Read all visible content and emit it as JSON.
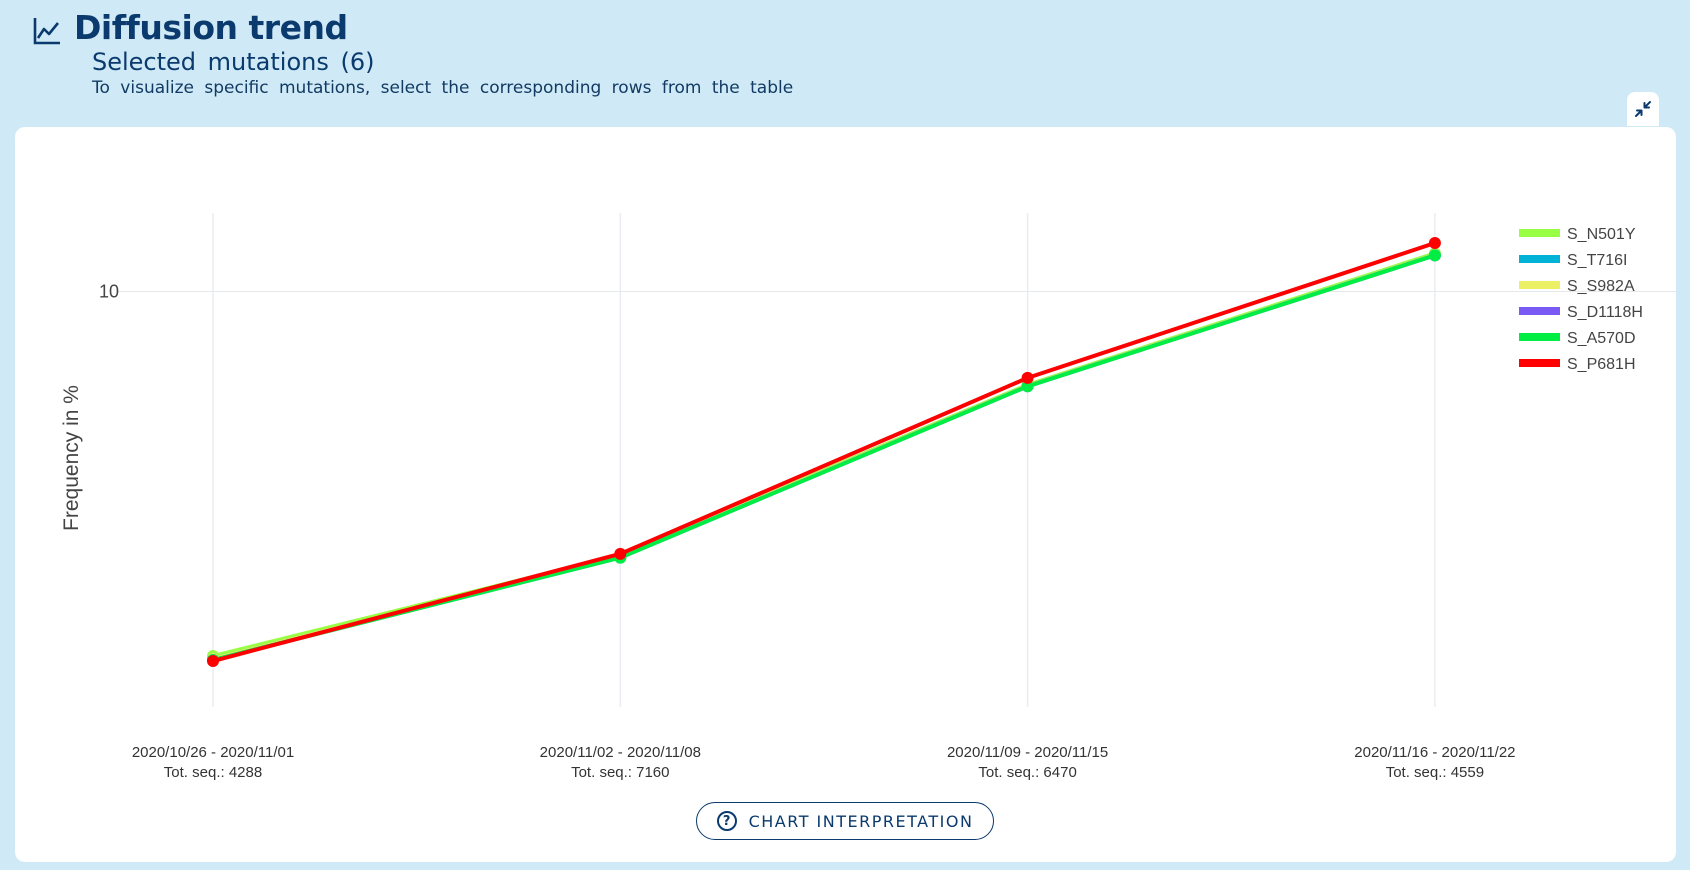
{
  "header": {
    "title": "Diffusion trend",
    "subtitle": "Selected mutations (6)",
    "hint": "To visualize specific mutations, select the corresponding rows from the table"
  },
  "icons": {
    "title": "line-chart-icon",
    "collapse": "collapse-arrows-icon",
    "help": "question-circle-icon"
  },
  "buttons": {
    "interpretation": "CHART INTERPRETATION",
    "help_glyph": "?"
  },
  "chart_data": {
    "type": "line",
    "ylabel": "Frequency in %",
    "yscale": "log",
    "ylim": [
      3.2,
      12.4
    ],
    "yticks": [
      10
    ],
    "grid": true,
    "legend_position": "top-right",
    "categories": [
      "2020/10/26 - 2020/11/01",
      "2020/11/02 - 2020/11/08",
      "2020/11/09 - 2020/11/15",
      "2020/11/16 - 2020/11/22"
    ],
    "category_sublabels": [
      "Tot. seq.: 4288",
      "Tot. seq.: 7160",
      "Tot. seq.: 6470",
      "Tot. seq.: 4559"
    ],
    "series": [
      {
        "name": "S_N501Y",
        "color": "#99ff44",
        "values": [
          3.68,
          4.85,
          7.74,
          11.1
        ]
      },
      {
        "name": "S_T716I",
        "color": "#00b3d6",
        "values": [
          3.65,
          4.83,
          7.72,
          11.05
        ]
      },
      {
        "name": "S_S982A",
        "color": "#ecf065",
        "values": [
          3.65,
          4.83,
          7.72,
          11.05
        ]
      },
      {
        "name": "S_D1118H",
        "color": "#7a5af5",
        "values": [
          3.64,
          4.82,
          7.71,
          11.04
        ]
      },
      {
        "name": "S_A570D",
        "color": "#00ee44",
        "values": [
          3.64,
          4.82,
          7.71,
          11.04
        ]
      },
      {
        "name": "S_P681H",
        "color": "#ff0000",
        "values": [
          3.63,
          4.87,
          7.89,
          11.42
        ]
      }
    ]
  }
}
